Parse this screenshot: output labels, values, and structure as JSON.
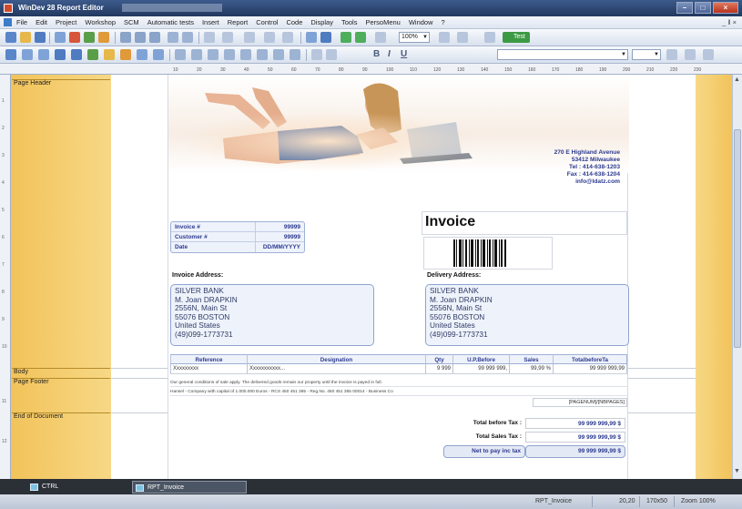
{
  "window": {
    "title": "WinDev 28 Report Editor"
  },
  "menubar": {
    "items": [
      "File",
      "Edit",
      "Project",
      "Workshop",
      "SCM",
      "Automatic tests",
      "Insert",
      "Report",
      "Control",
      "Code",
      "Display",
      "Tools",
      "PersoMenu",
      "Window",
      "?"
    ],
    "mdi_controls": "_ ‖ ×"
  },
  "toolbar": {
    "zoom_value": "100%",
    "test_label": "Test",
    "bold_label": "B",
    "italic_label": "I",
    "underline_label": "U"
  },
  "ruler": {
    "ticks": [
      "10",
      "20",
      "30",
      "40",
      "50",
      "60",
      "70",
      "80",
      "90",
      "100",
      "110",
      "120",
      "130",
      "140",
      "150",
      "160",
      "170",
      "180",
      "190",
      "200",
      "210",
      "220",
      "230"
    ]
  },
  "sections": {
    "page_header": "Page Header",
    "body": "Body",
    "page_footer": "Page Footer",
    "end_of_document": "End of Document"
  },
  "company": {
    "street": "270 E Highland Avenue",
    "city": "53412 Milwaukee",
    "tel": "Tel : 414-638-1203",
    "fax": "Fax : 414-638-1204",
    "email": "info@ldatz.com"
  },
  "invoice": {
    "title": "Invoice",
    "fields": [
      {
        "key": "Invoice #",
        "value": "99999"
      },
      {
        "key": "Customer #",
        "value": "99999"
      },
      {
        "key": "Date",
        "value": "DD/MM/YYYY"
      }
    ]
  },
  "invoice_address": {
    "label": "Invoice Address:",
    "lines": [
      "SILVER BANK",
      "M. Joan DRAPKIN",
      "2556N, Main St",
      "55076 BOSTON",
      "United States",
      "(49)099-1773731"
    ]
  },
  "delivery_address": {
    "label": "Delivery Address:",
    "lines": [
      "SILVER BANK",
      "M. Joan DRAPKIN",
      "2556N, Main St",
      "55076 BOSTON",
      "United States",
      "(49)099-1773731"
    ]
  },
  "grid": {
    "headers": [
      "Reference",
      "Designation",
      "Qty",
      "U.P.Before",
      "Sales",
      "TotalbeforeTa"
    ],
    "row": [
      "Xxxxxxxxx",
      "Xxxxxxxxxxx...",
      "9 999",
      "99 999 999,",
      "99,99 %",
      "99 999 999,99"
    ]
  },
  "footer": {
    "conditions": "Our general conditions of sale apply. The delivered goods remain our property until the invoice is payed in full.",
    "company_line": "Hansel - Company with capital of 1.000.000 Euros - RCS 450 451 365 - Reg.No. 450 451 365 00014 - Business Co",
    "page_number": "[PAGENUM]/[NBPAGES]"
  },
  "totals": [
    {
      "label": "Total before Tax :",
      "value": "99 999 999,99 $"
    },
    {
      "label": "Total Sales Tax :",
      "value": "99 999 999,99 $"
    },
    {
      "label": "Net to pay inc tax",
      "value": "99 999 999,99 $"
    }
  ],
  "bottom": {
    "panel_tab_1": "CTRL",
    "panel_tab_2": "RPT_Invoice",
    "status_report": "RPT_Invoice",
    "status_pos": "20,20",
    "status_size": "170x50",
    "status_zoom": "Zoom 100%"
  },
  "colors": {
    "margin": "#f2c35a",
    "accent_text": "#2c3a8f",
    "box_fill": "#eef3fb"
  }
}
